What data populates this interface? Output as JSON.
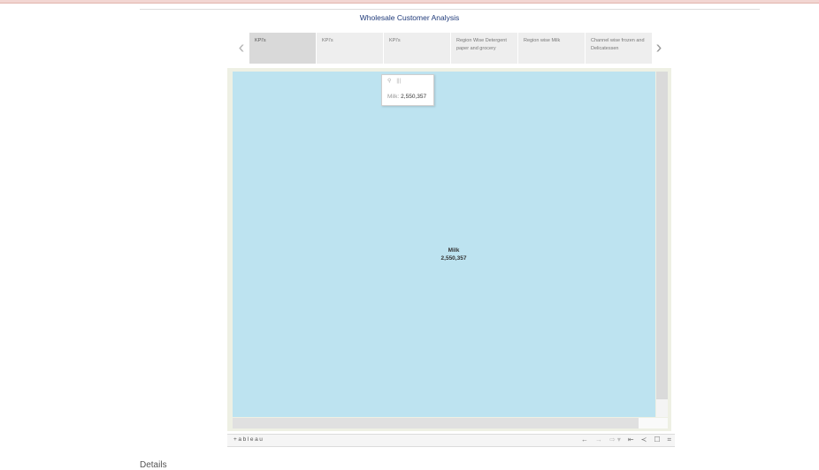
{
  "title": "Wholesale Customer Analysis",
  "nav": {
    "prev_icon": "‹",
    "next_icon": "›"
  },
  "tabs": [
    {
      "label": "KPI's",
      "active": true
    },
    {
      "label": "KPI's",
      "active": false
    },
    {
      "label": "KPI's",
      "active": false
    },
    {
      "label": "Region Wise Detergent paper and grocery",
      "active": false
    },
    {
      "label": "Region wise Milk",
      "active": false
    },
    {
      "label": "Channel wise frozen and Delicatessen",
      "active": false
    }
  ],
  "viz": {
    "mark_name": "Milk",
    "mark_value": "2,550,357",
    "fill_color": "#bde3f0"
  },
  "tooltip": {
    "icons": [
      "pin-icon",
      "table-icon"
    ],
    "key": "Milk:",
    "value": "2,550,357"
  },
  "toolbar": {
    "brand": "+ableau",
    "icons": [
      "undo-icon",
      "redo-icon",
      "revert-icon",
      "revert-all-icon",
      "share-icon",
      "comment-icon",
      "fullscreen-icon"
    ]
  },
  "details_label": "Details"
}
